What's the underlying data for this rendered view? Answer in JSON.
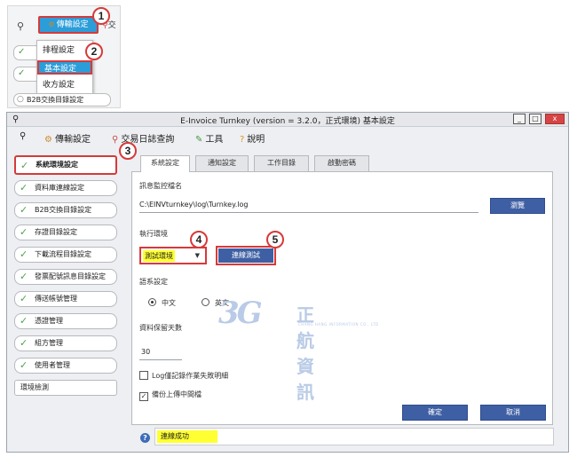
{
  "inset": {
    "menu_label": "傳輸設定",
    "search_stub": "交",
    "dropdown": [
      "排程設定",
      "基本設定",
      "收方設定"
    ],
    "b2b_label": "B2B交換目錄設定"
  },
  "callouts": [
    "1",
    "2",
    "3",
    "4",
    "5"
  ],
  "window": {
    "title": "E-Invoice Turnkey (version = 3.2.0，正式環境) 基本設定",
    "buttons": {
      "minimize": "_",
      "maximize": "□",
      "close": "x"
    }
  },
  "toolbar": {
    "transfer": "傳輸設定",
    "log_query": "交易日誌查詢",
    "tools": "工具",
    "help": "說明"
  },
  "sidebar": {
    "items": [
      "系統環境設定",
      "資料庫連線設定",
      "B2B交換目錄設定",
      "存證目錄設定",
      "下載流程目錄設定",
      "發票配號訊息目錄設定",
      "傳送帳號管理",
      "憑證管理",
      "組方管理",
      "使用者管理",
      "環境檢測"
    ]
  },
  "tabs": [
    "系統設定",
    "通知設定",
    "工作目錄",
    "啟動密碼"
  ],
  "form": {
    "monitor_label": "訊息監控檔名",
    "monitor_path": "C:\\EINVturnkey\\log\\Turnkey.log",
    "browse": "瀏覽",
    "env_label": "執行環境",
    "env_value": "測試環境",
    "conn_test": "連線測試",
    "lang_label": "語系設定",
    "lang_zh": "中文",
    "lang_en": "英文",
    "days_label": "資料保留天數",
    "days_value": "30",
    "log_fail_only": "Log僅記錄作業失敗明細",
    "backup_upload": "備份上傳中間檔",
    "log_fail_only_checked": false,
    "backup_upload_checked": true,
    "lang_selected": "zh",
    "confirm": "確定",
    "cancel": "取消"
  },
  "logo": {
    "mark": "3G",
    "name": "正航資訊",
    "sub": "CHANG HANG INFORMATION CO., LTD"
  },
  "status": {
    "help_icon": "?",
    "message": "連線成功"
  },
  "colors": {
    "accent_blue": "#3e5fa3",
    "menu_blue": "#2b9dd9",
    "callout_red": "#d63a3a",
    "highlight_yellow": "#ffff32"
  }
}
